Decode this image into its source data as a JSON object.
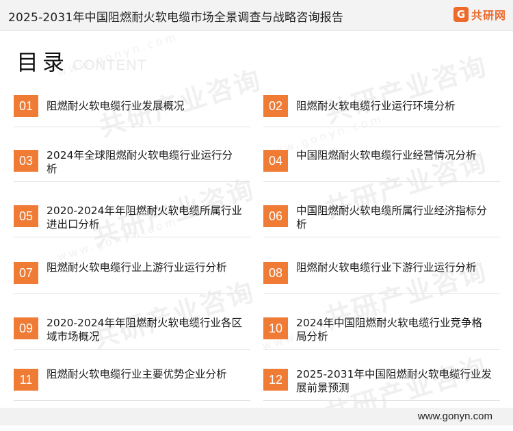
{
  "header": {
    "report_title": "2025-2031年中国阻燃耐火软电缆市场全景调查与战略咨询报告",
    "brand_mark": "G",
    "brand_name": "共研网"
  },
  "heading": {
    "main": "目录",
    "sub": "CONTENT"
  },
  "watermark": {
    "text": "共研产业咨询",
    "url": "www.gonyn.com"
  },
  "toc": [
    {
      "num": "01",
      "label": "阻燃耐火软电缆行业发展概况"
    },
    {
      "num": "02",
      "label": "阻燃耐火软电缆行业运行环境分析"
    },
    {
      "num": "03",
      "label": "2024年全球阻燃耐火软电缆行业运行分析"
    },
    {
      "num": "04",
      "label": "中国阻燃耐火软电缆行业经营情况分析"
    },
    {
      "num": "05",
      "label": "2020-2024年年阻燃耐火软电缆所属行业进出口分析"
    },
    {
      "num": "06",
      "label": "中国阻燃耐火软电缆所属行业经济指标分析"
    },
    {
      "num": "07",
      "label": "阻燃耐火软电缆行业上游行业运行分析"
    },
    {
      "num": "08",
      "label": "阻燃耐火软电缆行业下游行业运行分析"
    },
    {
      "num": "09",
      "label": "2020-2024年年阻燃耐火软电缆行业各区域市场概况"
    },
    {
      "num": "10",
      "label": "2024年中国阻燃耐火软电缆行业竞争格局分析"
    },
    {
      "num": "11",
      "label": "阻燃耐火软电缆行业主要优势企业分析"
    },
    {
      "num": "12",
      "label": "2025-2031年中国阻燃耐火软电缆行业发展前景预测"
    }
  ],
  "footer": {
    "url": "www.gonyn.com"
  },
  "colors": {
    "accent": "#ef7b34",
    "brand": "#ec6a2b"
  }
}
